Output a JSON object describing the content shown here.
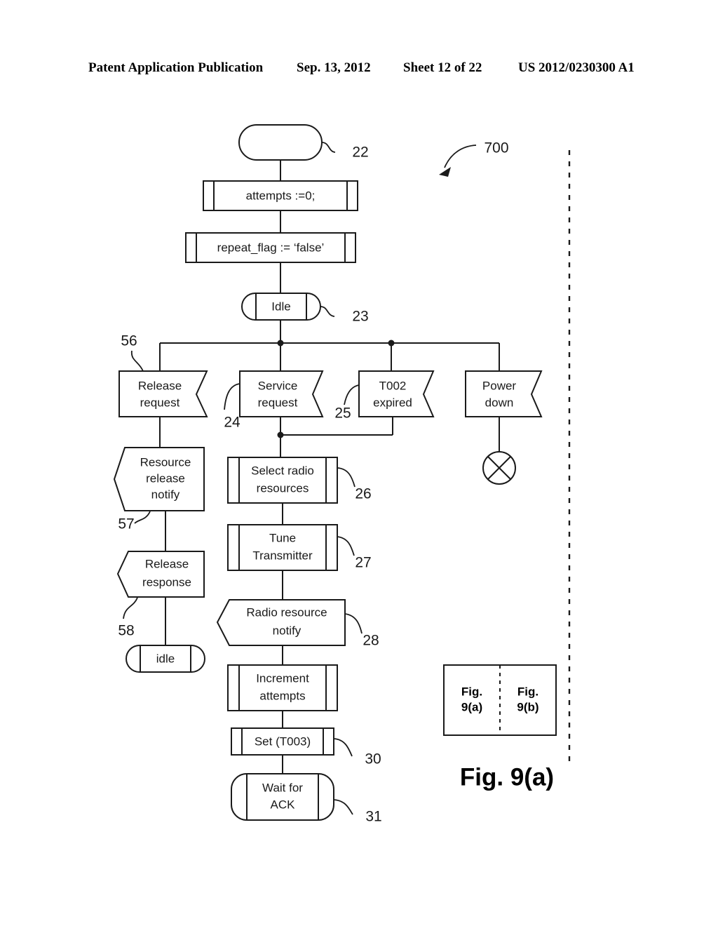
{
  "header": {
    "publication": "Patent Application Publication",
    "date": "Sep. 13, 2012",
    "sheet": "Sheet 12 of 22",
    "patent_number": "US 2012/0230300 A1"
  },
  "figure": {
    "caption": "Fig. 9(a)",
    "diagram_reference": "700",
    "key": {
      "left_line1": "Fig.",
      "left_line2": "9(a)",
      "right_line1": "Fig.",
      "right_line2": "9(b)"
    }
  },
  "nodes": {
    "start": {
      "label": "",
      "ref": "22",
      "type": "start-oval"
    },
    "task_attempts": {
      "label": "attempts :=0;",
      "type": "task"
    },
    "task_repeat_flag": {
      "label": "repeat_flag := ‘false’",
      "type": "task"
    },
    "state_idle": {
      "label": "Idle",
      "ref": "23",
      "type": "state"
    },
    "input_release_request": {
      "line1": "Release",
      "line2": "request",
      "ref": "56",
      "type": "input"
    },
    "input_service_request": {
      "line1": "Service",
      "line2": "request",
      "ref": "24",
      "type": "input"
    },
    "input_t002_expired": {
      "line1": "T002",
      "line2": "expired",
      "ref": "25",
      "type": "input"
    },
    "input_power_down": {
      "line1": "Power",
      "line2": "down",
      "type": "input"
    },
    "stop_terminator": {
      "type": "stop-circle-x"
    },
    "output_resource_release_notify": {
      "line1": "Resource",
      "line2": "release",
      "line3": "notify",
      "ref": "57",
      "type": "output"
    },
    "output_release_response": {
      "line1": "Release",
      "line2": "response",
      "ref": "58",
      "type": "output"
    },
    "state_idle_lower": {
      "label": "idle",
      "type": "state"
    },
    "task_select_radio": {
      "line1": "Select radio",
      "line2": "resources",
      "ref": "26",
      "type": "task"
    },
    "task_tune_transmitter": {
      "line1": "Tune",
      "line2": "Transmitter",
      "ref": "27",
      "type": "task"
    },
    "output_radio_resource_notify": {
      "line1": "Radio resource",
      "line2": "notify",
      "ref": "28",
      "type": "output"
    },
    "task_increment_attempts": {
      "line1": "Increment",
      "line2": "attempts",
      "type": "task"
    },
    "task_set_t003": {
      "label": "Set (T003)",
      "ref": "30",
      "type": "task"
    },
    "state_wait_for_ack": {
      "line1": "Wait for",
      "line2": "ACK",
      "ref": "31",
      "type": "state"
    }
  },
  "colors": {
    "ink": "#1a1a1a",
    "paper": "#ffffff"
  }
}
